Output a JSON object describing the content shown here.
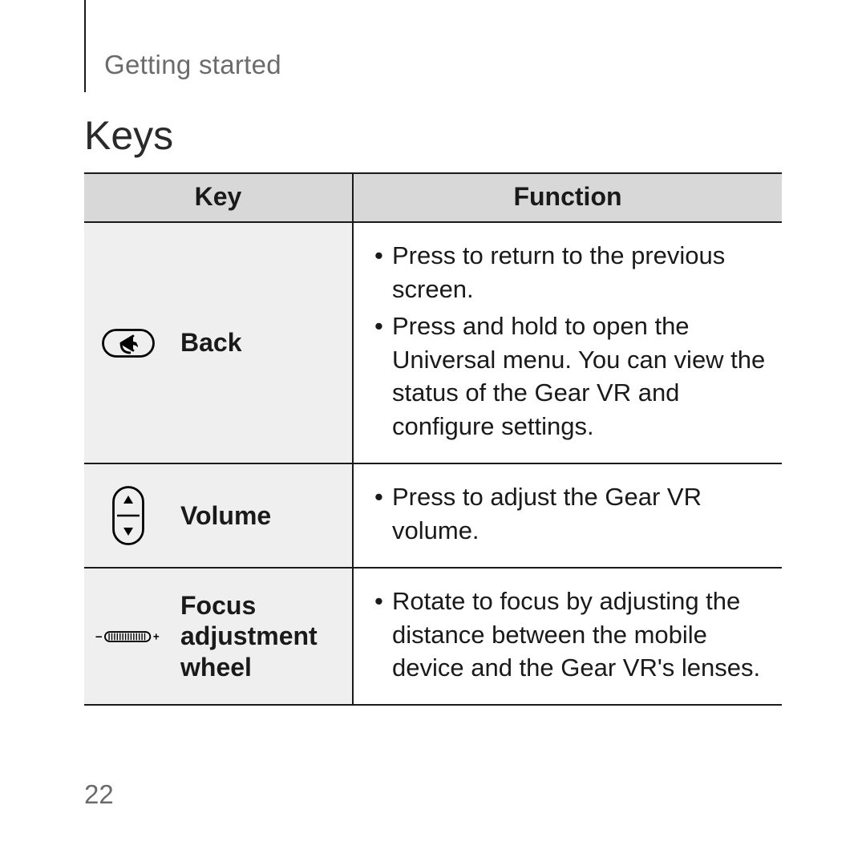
{
  "header": {
    "section": "Getting started"
  },
  "heading": "Keys",
  "table": {
    "columns": {
      "key": "Key",
      "function": "Function"
    },
    "rows": [
      {
        "icon": "back-icon",
        "name": "Back",
        "functions": [
          "Press to return to the previous screen.",
          "Press and hold to open the Universal menu. You can view the status of the Gear VR and configure settings."
        ]
      },
      {
        "icon": "volume-icon",
        "name": "Volume",
        "functions": [
          "Press to adjust the Gear VR volume."
        ]
      },
      {
        "icon": "focus-wheel-icon",
        "name": "Focus adjustment wheel",
        "functions": [
          "Rotate to focus by adjusting the distance between the mobile device and the Gear VR's lenses."
        ]
      }
    ]
  },
  "page_number": "22"
}
